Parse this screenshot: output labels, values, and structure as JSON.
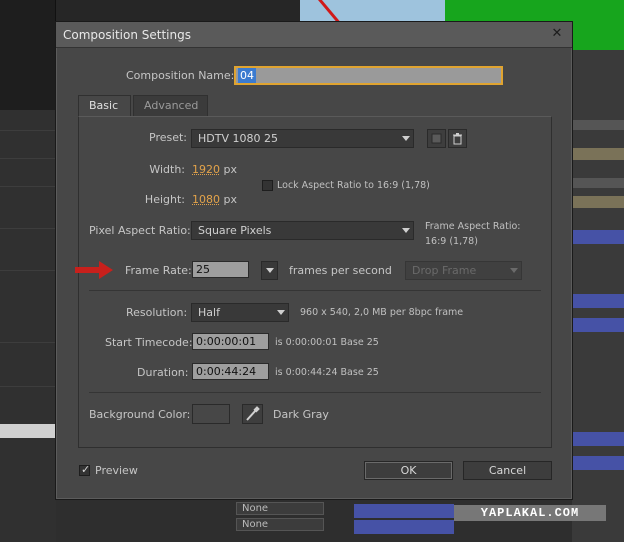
{
  "dialog": {
    "title": "Composition Settings",
    "composition_name_label": "Composition Name:",
    "composition_name_value": "04",
    "tabs": [
      {
        "label": "Basic"
      },
      {
        "label": "Advanced"
      }
    ],
    "preset": {
      "label": "Preset:",
      "value": "HDTV 1080 25"
    },
    "width": {
      "label": "Width:",
      "value": "1920",
      "unit": "px"
    },
    "height": {
      "label": "Height:",
      "value": "1080",
      "unit": "px"
    },
    "lock_aspect": {
      "label": "Lock Aspect Ratio to 16:9 (1,78)",
      "checked": false
    },
    "pixel_aspect": {
      "label": "Pixel Aspect Ratio:",
      "value": "Square Pixels"
    },
    "frame_aspect": {
      "label": "Frame Aspect Ratio:",
      "value": "16:9 (1,78)"
    },
    "frame_rate": {
      "label": "Frame Rate:",
      "value": "25",
      "unit": "frames per second",
      "drop_frame": "Drop Frame"
    },
    "resolution": {
      "label": "Resolution:",
      "value": "Half",
      "info": "960 x 540, 2,0 MB per 8bpc frame"
    },
    "start_timecode": {
      "label": "Start Timecode:",
      "value": "0:00:00:01",
      "info": "is 0:00:00:01  Base 25"
    },
    "duration": {
      "label": "Duration:",
      "value": "0:00:44:24",
      "info": "is 0:00:44:24  Base 25"
    },
    "background": {
      "label": "Background Color:",
      "value": "Dark Gray",
      "color": "#474747"
    },
    "preview": {
      "label": "Preview",
      "checked": true
    },
    "ok_label": "OK",
    "cancel_label": "Cancel"
  },
  "background_app": {
    "layer_mode_1": "None",
    "layer_mode_2": "None",
    "watermark": "YAPLAKAL.COM"
  },
  "colors": {
    "accent_orange": "#e3a34a",
    "arrow_red": "#c8201c",
    "selection_blue": "#3b7bd0"
  }
}
